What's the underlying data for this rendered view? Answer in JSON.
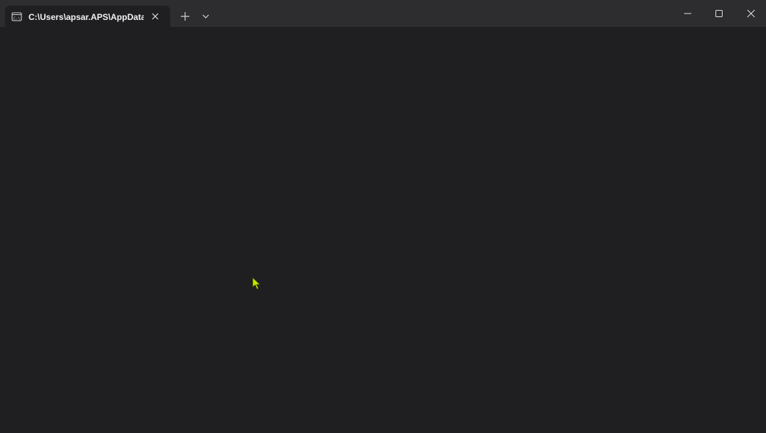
{
  "tab": {
    "title": "C:\\Users\\apsar.APS\\AppData\\",
    "icon": "terminal-icon"
  },
  "toolbar": {
    "new_tab_icon": "plus-icon",
    "dropdown_icon": "chevron-down-icon"
  },
  "window_controls": {
    "minimize_icon": "minimize-icon",
    "maximize_icon": "maximize-icon",
    "close_icon": "close-icon"
  },
  "colors": {
    "titlebar": "#2d2d30",
    "background": "#1f1f21",
    "text": "#f2f2f2",
    "cursor": "#c8e600"
  }
}
